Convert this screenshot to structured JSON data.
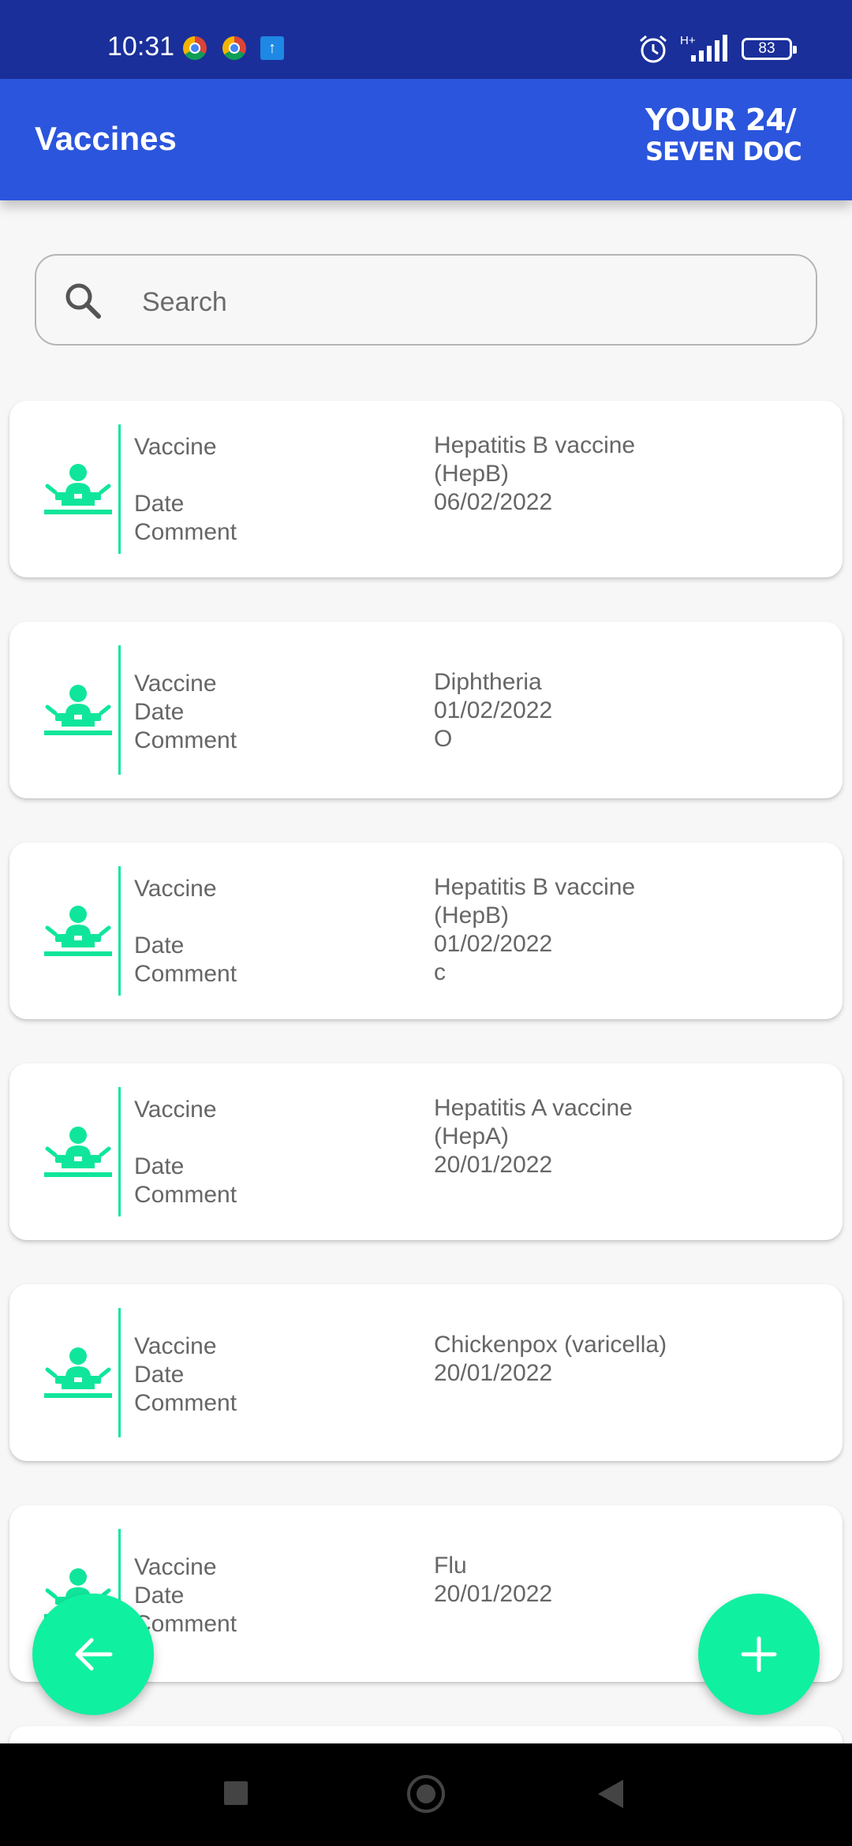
{
  "status_bar": {
    "time": "10:31",
    "network": "H+",
    "battery": "83"
  },
  "app_bar": {
    "title": "Vaccines",
    "logo_line1": "YOUR 24/",
    "logo_line2": "SEVEN DOC"
  },
  "search": {
    "placeholder": "Search",
    "value": ""
  },
  "labels": {
    "vaccine": "Vaccine",
    "date": "Date",
    "comment": "Comment"
  },
  "records": [
    {
      "vaccine": "Hepatitis B vaccine\n(HepB)",
      "date": "06/02/2022",
      "comment": ""
    },
    {
      "vaccine": "Diphtheria",
      "date": "01/02/2022",
      "comment": "O"
    },
    {
      "vaccine": "Hepatitis B vaccine\n(HepB)",
      "date": "01/02/2022",
      "comment": "c"
    },
    {
      "vaccine": "Hepatitis A vaccine\n(HepA)",
      "date": "20/01/2022",
      "comment": ""
    },
    {
      "vaccine": "Chickenpox (varicella)",
      "date": "20/01/2022",
      "comment": ""
    },
    {
      "vaccine": "Flu",
      "date": "20/01/2022",
      "comment": ""
    }
  ],
  "colors": {
    "status_bar": "#1a2f9a",
    "app_bar": "#2b55dc",
    "accent": "#10f0a1",
    "divider": "#10e69b"
  },
  "icons": {
    "back_fab": "arrow-left-icon",
    "add_fab": "plus-icon",
    "record": "vaccination-icon"
  }
}
